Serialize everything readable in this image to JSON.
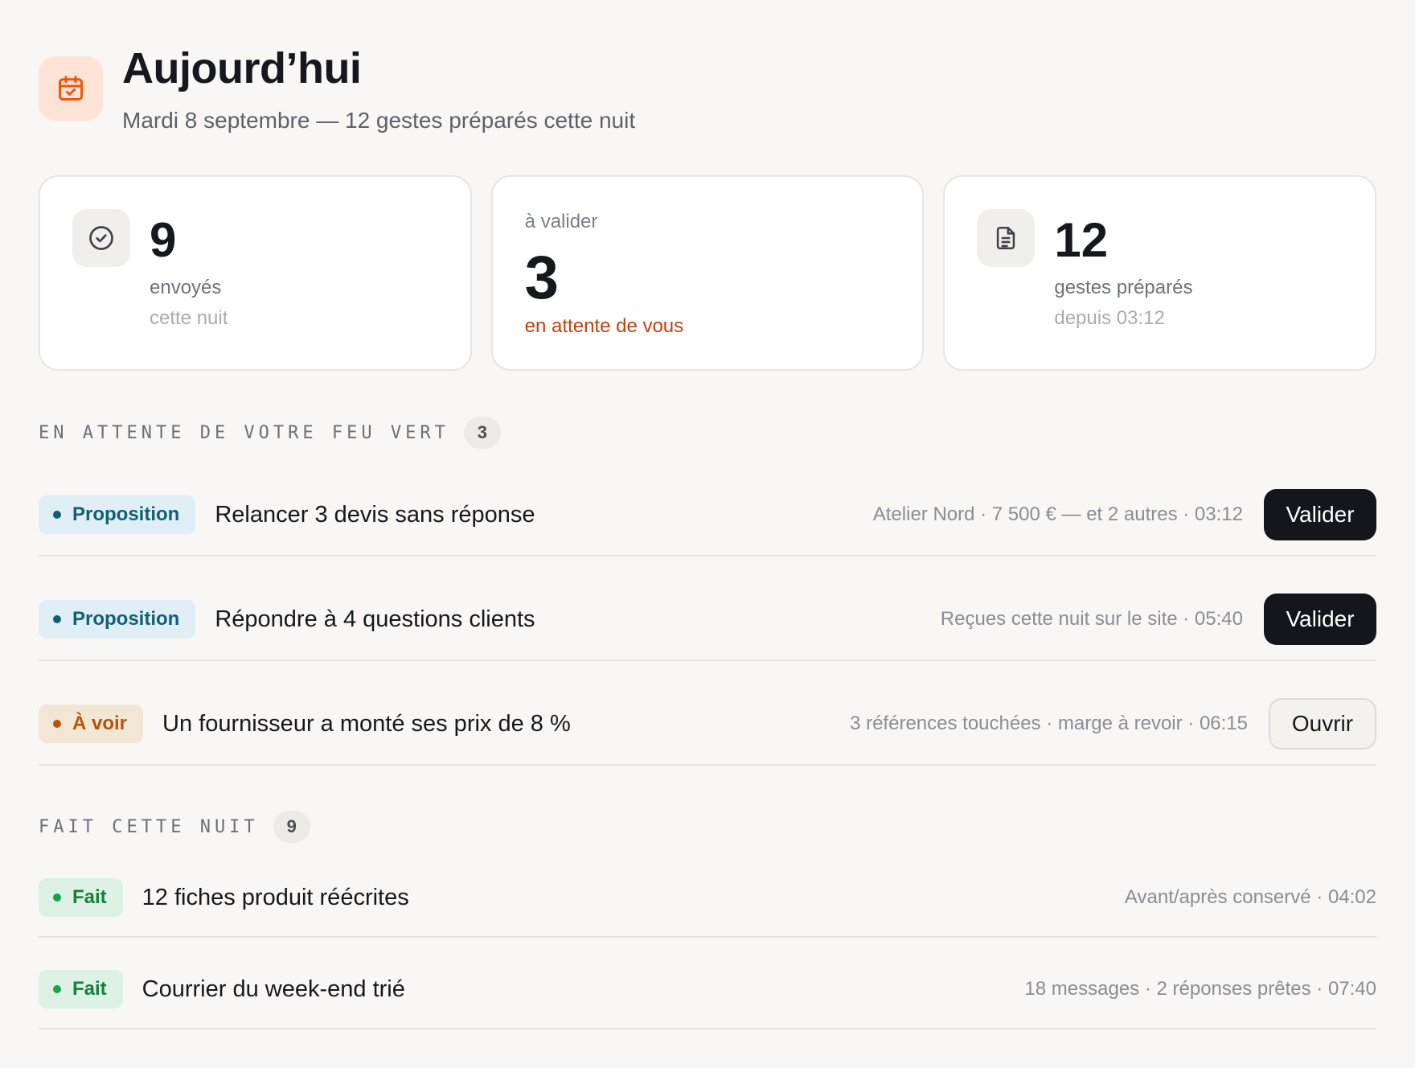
{
  "header": {
    "icon": "calendar-check-icon",
    "title": "Aujourd’hui",
    "subtitle": "Mardi 8 septembre — 12 gestes préparés cette nuit"
  },
  "stats": {
    "sent": {
      "icon": "check-circle-icon",
      "value": "9",
      "label": "envoyés",
      "sublabel": "cette nuit"
    },
    "pending": {
      "label": "à valider",
      "value": "3",
      "note": "en attente de vous",
      "note_color": "#c2410c"
    },
    "prepared": {
      "icon": "document-icon",
      "value": "12",
      "label": "gestes préparés",
      "sublabel": "depuis 03:12"
    }
  },
  "pending_section": {
    "title": "EN ATTENTE DE VOTRE FEU VERT",
    "count": "3",
    "items": [
      {
        "badge": "Proposition",
        "title": "Relancer 3 devis sans réponse",
        "meta": "Atelier Nord · 7 500 € — et 2 autres · 03:12",
        "action": "Valider"
      },
      {
        "badge": "Proposition",
        "title": "Répondre à 4 questions clients",
        "meta": "Reçues cette nuit sur le site · 05:40",
        "action": "Valider"
      },
      {
        "badge": "À voir",
        "title": "Un fournisseur a monté ses prix de 8 %",
        "meta": "3 références touchées · marge à revoir · 06:15",
        "action": "Ouvrir"
      }
    ]
  },
  "done_section": {
    "title": "FAIT CETTE NUIT",
    "count": "9",
    "items": [
      {
        "badge": "Fait",
        "title": "12 fiches produit réécrites",
        "meta": "Avant/après conservé · 04:02"
      },
      {
        "badge": "Fait",
        "title": "Courrier du week-end trié",
        "meta": "18 messages · 2 réponses prêtes · 07:40"
      }
    ]
  },
  "colors": {
    "accent": "#ea580c",
    "proposition": "#155e75",
    "a_voir": "#b45309",
    "fait": "#15803d",
    "primary_button": "#14161b"
  }
}
